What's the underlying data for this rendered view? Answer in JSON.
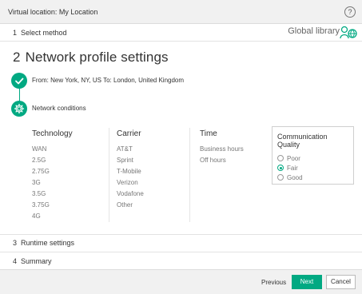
{
  "window": {
    "title": "Virtual location: My Location",
    "help_glyph": "?"
  },
  "steps": {
    "step1": {
      "number": "1",
      "label": "Select method"
    },
    "step2": {
      "number": "2",
      "label": "Network profile settings"
    },
    "step3": {
      "number": "3",
      "label": "Runtime settings"
    },
    "step4": {
      "number": "4",
      "label": "Summary"
    }
  },
  "header_right": {
    "global_library_label": "Global library",
    "icon": "user-globe-icon"
  },
  "progress": {
    "route_text": "From: New York, NY, US To: London, United Kingdom",
    "conditions_label": "Network conditions"
  },
  "technology": {
    "heading": "Technology",
    "items": [
      "WAN",
      "2.5G",
      "2.75G",
      "3G",
      "3.5G",
      "3.75G",
      "4G"
    ]
  },
  "carrier": {
    "heading": "Carrier",
    "items": [
      "AT&T",
      "Sprint",
      "T-Mobile",
      "Verizon",
      "Vodafone",
      "Other"
    ]
  },
  "time": {
    "heading": "Time",
    "items": [
      "Business hours",
      "Off hours"
    ]
  },
  "quality": {
    "heading": "Communication Quality",
    "options": [
      "Poor",
      "Fair",
      "Good"
    ],
    "selected": "Fair"
  },
  "footer": {
    "previous_label": "Previous",
    "next_label": "Next",
    "cancel_label": "Cancel"
  },
  "colors": {
    "accent": "#01a982",
    "bar_bg": "#f1f1f1"
  }
}
